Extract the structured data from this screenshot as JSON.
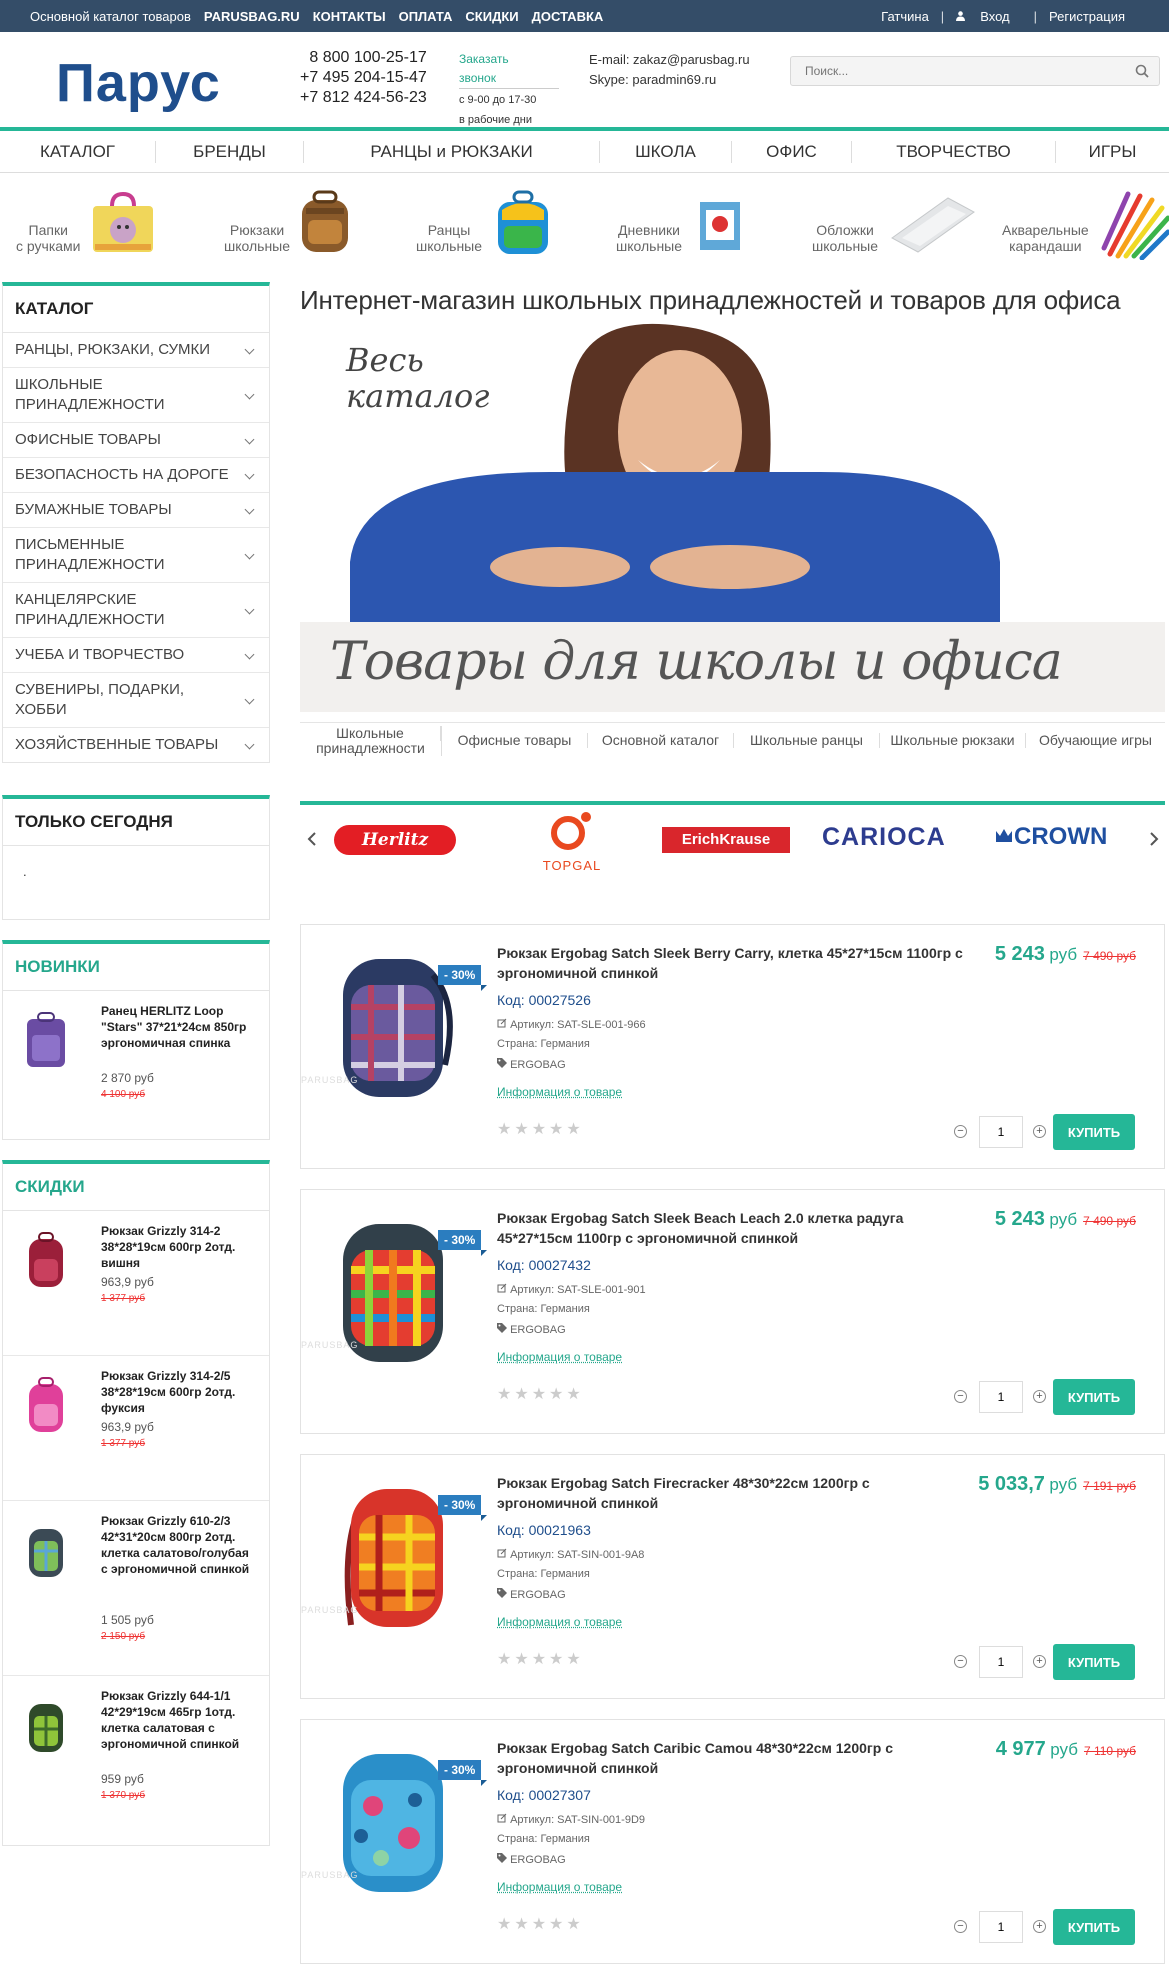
{
  "topbar": {
    "links": [
      "Основной каталог товаров",
      "PARUSBAG.RU",
      "КОНТАКТЫ",
      "ОПЛАТА",
      "СКИДКИ",
      "ДОСТАВКА"
    ],
    "city": "Гатчина",
    "login": "Вход",
    "register": "Регистрация",
    "separator": "|"
  },
  "header": {
    "logo": "Парус",
    "phone1": "8 800 100-25-17",
    "phone2": "+7 495 204-15-47",
    "phone3": "+7 812 424-56-23",
    "callback1": "Заказать",
    "callback2": "звонок",
    "hours1": "с 9-00 до 17-30",
    "hours2": "в рабочие дни",
    "email": "E-mail: zakaz@parusbag.ru",
    "skype": "Skype: paradmin69.ru",
    "search_placeholder": "Поиск..."
  },
  "mainnav": [
    "КАТАЛОГ",
    "БРЕНДЫ",
    "РАНЦЫ и РЮКЗАКИ",
    "ШКОЛА",
    "ОФИС",
    "ТВОРЧЕСТВО",
    "ИГРЫ"
  ],
  "categories": [
    {
      "l1": "Папки",
      "l2": "с ручками"
    },
    {
      "l1": "Рюкзаки",
      "l2": "школьные"
    },
    {
      "l1": "Ранцы",
      "l2": "школьные"
    },
    {
      "l1": "Дневники",
      "l2": "школьные"
    },
    {
      "l1": "Обложки",
      "l2": "школьные"
    },
    {
      "l1": "Акварельные",
      "l2": "карандаши"
    }
  ],
  "catalog": {
    "title": "КАТАЛОГ",
    "items": [
      "РАНЦЫ, РЮКЗАКИ, СУМКИ",
      "ШКОЛЬНЫЕ ПРИНАДЛЕЖНОСТИ",
      "ОФИСНЫЕ ТОВАРЫ",
      "БЕЗОПАСНОСТЬ НА ДОРОГЕ",
      "БУМАЖНЫЕ ТОВАРЫ",
      "ПИСЬМЕННЫЕ ПРИНАДЛЕЖНОСТИ",
      "КАНЦЕЛЯРСКИЕ ПРИНАДЛЕЖНОСТИ",
      "УЧЕБА И ТВОРЧЕСТВО",
      "СУВЕНИРЫ, ПОДАРКИ, ХОББИ",
      "ХОЗЯЙСТВЕННЫЕ ТОВАРЫ"
    ]
  },
  "today": {
    "title": "ТОЛЬКО СЕГОДНЯ",
    "dot": "."
  },
  "novinki": {
    "title": "НОВИНКИ",
    "items": [
      {
        "name": "Ранец HERLITZ Loop \"Stars\" 37*21*24см 850гр эргономичная спинка",
        "price": "2 870 руб",
        "old": "4 100 руб"
      }
    ]
  },
  "skidki": {
    "title": "СКИДКИ",
    "items": [
      {
        "name": "Рюкзак Grizzly 314-2 38*28*19см 600гр 2отд. вишня",
        "price": "963,9 руб",
        "old": "1 377 руб"
      },
      {
        "name": "Рюкзак Grizzly 314-2/5 38*28*19см 600гр 2отд. фуксия",
        "price": "963,9 руб",
        "old": "1 377 руб"
      },
      {
        "name": "Рюкзак Grizzly 610-2/3 42*31*20см 800гр 2отд. клетка салатово/голубая с эргономичной спинкой",
        "price": "1 505 руб",
        "old": "2 150 руб"
      },
      {
        "name": "Рюкзак Grizzly 644-1/1 42*29*19см 465гр 1отд. клетка салатовая с эргономичной спинкой",
        "price": "959 руб",
        "old": "1 370 руб"
      }
    ]
  },
  "main": {
    "headline": "Интернет-магазин школьных принадлежностей и товаров для офиса",
    "banner_small1": "Весь",
    "banner_small2": "каталог",
    "banner_big": "Товары для школы и офиса",
    "tabs": [
      {
        "l1": "Школьные",
        "l2": "принадлежности"
      },
      {
        "l1": "Офисные товары",
        "l2": ""
      },
      {
        "l1": "Основной каталог",
        "l2": ""
      },
      {
        "l1": "Школьные ранцы",
        "l2": ""
      },
      {
        "l1": "Школьные рюкзаки",
        "l2": ""
      },
      {
        "l1": "Обучающие игры",
        "l2": ""
      }
    ]
  },
  "brands": [
    "Herlitz",
    "TOPGAL",
    "ErichKrause",
    "CARIOCA",
    "CROWN"
  ],
  "products": [
    {
      "name": "Рюкзак Ergobag Satch Sleek Berry Carry, клетка 45*27*15см 1100гр с эргономичной спинкой",
      "code": "Код: 00027526",
      "article": "Артикул: SAT-SLE-001-966",
      "country": "Страна: Германия",
      "brand": "ERGOBAG",
      "info": "Информация о товаре",
      "price": "5 243",
      "unit": "руб",
      "old": "7 490 руб",
      "discount": "- 30%",
      "qty": "1",
      "buy": "КУПИТЬ",
      "stars": "★★★★★",
      "wm": "PARUSBAG"
    },
    {
      "name": "Рюкзак Ergobag Satch Sleek Beach Leach 2.0 клетка радуга 45*27*15см 1100гр с эргономичной спинкой",
      "code": "Код: 00027432",
      "article": "Артикул: SAT-SLE-001-901",
      "country": "Страна: Германия",
      "brand": "ERGOBAG",
      "info": "Информация о товаре",
      "price": "5 243",
      "unit": "руб",
      "old": "7 490 руб",
      "discount": "- 30%",
      "qty": "1",
      "buy": "КУПИТЬ",
      "stars": "★★★★★",
      "wm": "PARUSBAG"
    },
    {
      "name": "Рюкзак Ergobag Satch Firecracker 48*30*22см 1200гр с эргономичной спинкой",
      "code": "Код: 00021963",
      "article": "Артикул: SAT-SIN-001-9A8",
      "country": "Страна: Германия",
      "brand": "ERGOBAG",
      "info": "Информация о товаре",
      "price": "5 033,7",
      "unit": "руб",
      "old": "7 191 руб",
      "discount": "- 30%",
      "qty": "1",
      "buy": "КУПИТЬ",
      "stars": "★★★★★",
      "wm": "PARUSBAG"
    },
    {
      "name": "Рюкзак Ergobag Satch Caribic Camou 48*30*22см 1200гр с эргономичной спинкой",
      "code": "Код: 00027307",
      "article": "Артикул: SAT-SIN-001-9D9",
      "country": "Страна: Германия",
      "brand": "ERGOBAG",
      "info": "Информация о товаре",
      "price": "4 977",
      "unit": "руб",
      "old": "7 110 руб",
      "discount": "- 30%",
      "qty": "1",
      "buy": "КУПИТЬ",
      "stars": "★★★★★",
      "wm": "PARUSBAG"
    }
  ],
  "colors": {
    "topbar": "#344d68",
    "accent": "#25b797",
    "logo": "#1f4e8c",
    "badge": "#2b7dbf",
    "old_price": "#e33333"
  }
}
